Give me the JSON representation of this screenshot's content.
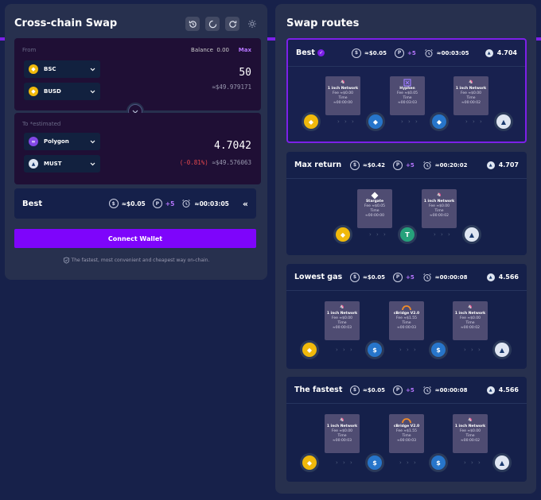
{
  "swap": {
    "title": "Cross-chain Swap",
    "from": {
      "label": "From",
      "balance_label": "Balance",
      "balance_value": "0.00",
      "max_label": "Max",
      "chain": "BSC",
      "token": "BUSD",
      "amount": "50",
      "usd": "≈$49.979171"
    },
    "to": {
      "label": "To *estimated",
      "chain": "Polygon",
      "token": "MUST",
      "amount": "4.7042",
      "pct": "(-0.81%)",
      "usd": "≈$49.576063"
    },
    "route": {
      "name": "Best",
      "fee": "≈$0.05",
      "points": "+5",
      "time": "≈00:03:05",
      "collapse": "«"
    },
    "connect_label": "Connect Wallet",
    "tagline": "The fastest, most convenient and cheapest way on-chain."
  },
  "routes": {
    "title": "Swap routes",
    "arrows": "› › ›",
    "cards": [
      {
        "name": "Best",
        "fee": "≈$0.05",
        "points": "+5",
        "time": "≈00:03:05",
        "output": "4.704",
        "hops": [
          {
            "name": "1 inch Network",
            "fee": "Fee ≈$0.00",
            "time_label": "Time",
            "time": "≈00:00:00"
          },
          {
            "name": "Hyphen",
            "fee": "Fee ≈$0.05",
            "time_label": "Time",
            "time": "≈00:03:03"
          },
          {
            "name": "1 inch Network",
            "fee": "Fee ≈$0.00",
            "time_label": "Time",
            "time": "≈00:00:02"
          }
        ]
      },
      {
        "name": "Max return",
        "fee": "≈$0.42",
        "points": "+5",
        "time": "≈00:20:02",
        "output": "4.707",
        "hops": [
          {
            "name": "Stargate",
            "fee": "Fee ≈$0.05",
            "time_label": "Time",
            "time": "≈00:00:00"
          },
          {
            "name": "1 inch Network",
            "fee": "Fee ≈$0.00",
            "time_label": "Time",
            "time": "≈00:00:02"
          }
        ]
      },
      {
        "name": "Lowest gas",
        "fee": "≈$0.05",
        "points": "+5",
        "time": "≈00:00:08",
        "output": "4.566",
        "hops": [
          {
            "name": "1 inch Network",
            "fee": "Fee ≈$0.00",
            "time_label": "Time",
            "time": "≈00:00:03"
          },
          {
            "name": "cBridge V2.0",
            "fee": "Fee ≈$1.55",
            "time_label": "Time",
            "time": "≈00:00:03"
          },
          {
            "name": "1 inch Network",
            "fee": "Fee ≈$0.00",
            "time_label": "Time",
            "time": "≈00:00:02"
          }
        ]
      },
      {
        "name": "The fastest",
        "fee": "≈$0.05",
        "points": "+5",
        "time": "≈00:00:08",
        "output": "4.566",
        "hops": [
          {
            "name": "1 inch Network",
            "fee": "Fee ≈$0.00",
            "time_label": "Time",
            "time": "≈00:00:03"
          },
          {
            "name": "cBridge V2.0",
            "fee": "Fee ≈$1.55",
            "time_label": "Time",
            "time": "≈00:00:03"
          },
          {
            "name": "1 inch Network",
            "fee": "Fee ≈$0.00",
            "time_label": "Time",
            "time": "≈00:00:02"
          }
        ]
      }
    ]
  },
  "icons": {
    "points": "P",
    "fee": "$",
    "busd_symbol": "◆",
    "usdc_symbol": "$",
    "usdt_symbol": "T",
    "eth_symbol": "◆"
  },
  "colors": {
    "accent": "#7c20e8",
    "connect": "#7e05fb",
    "negative": "#e5484d",
    "busd": "#f0b90b",
    "usdc": "#2775ca",
    "usdt": "#26a17b",
    "polygon": "#8247e5",
    "max": "#b675ff",
    "bg": "#17214a"
  }
}
